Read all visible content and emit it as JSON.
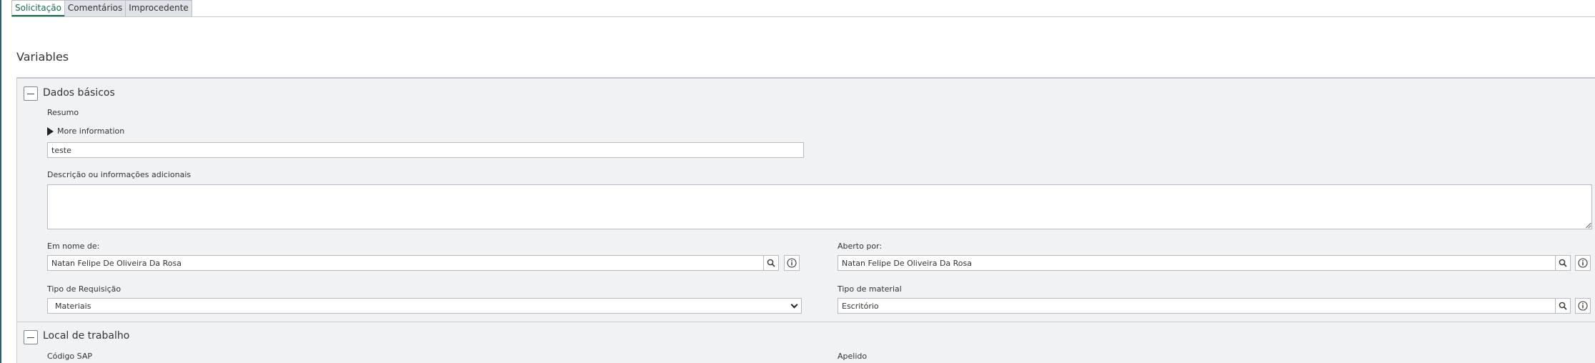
{
  "tabs": [
    {
      "label": "Solicitação",
      "active": true
    },
    {
      "label": "Comentários",
      "active": false
    },
    {
      "label": "Improcedente",
      "active": false
    }
  ],
  "variables_title": "Variables",
  "groups": {
    "basic": {
      "title": "Dados básicos",
      "resumo_label": "Resumo",
      "more_info_label": "More information",
      "resumo_value": "teste",
      "descricao_label": "Descrição ou informações adicionais",
      "descricao_value": "",
      "em_nome_label": "Em nome de:",
      "em_nome_value": "Natan Felipe De Oliveira Da Rosa",
      "aberto_por_label": "Aberto por:",
      "aberto_por_value": "Natan Felipe De Oliveira Da Rosa",
      "tipo_req_label": "Tipo de Requisição",
      "tipo_req_value": "Materiais",
      "tipo_mat_label": "Tipo de material",
      "tipo_mat_value": "Escritório"
    },
    "local": {
      "title": "Local de trabalho",
      "codigo_sap_label": "Código SAP",
      "apelido_label": "Apelido"
    }
  },
  "colors": {
    "active_tab": "#1d6b46",
    "panel_bg": "#f1f2f4",
    "border": "#b5bbc1"
  },
  "icons": [
    "search-icon",
    "info-icon",
    "chevron-down-icon",
    "triangle-right-icon",
    "collapse-icon"
  ]
}
